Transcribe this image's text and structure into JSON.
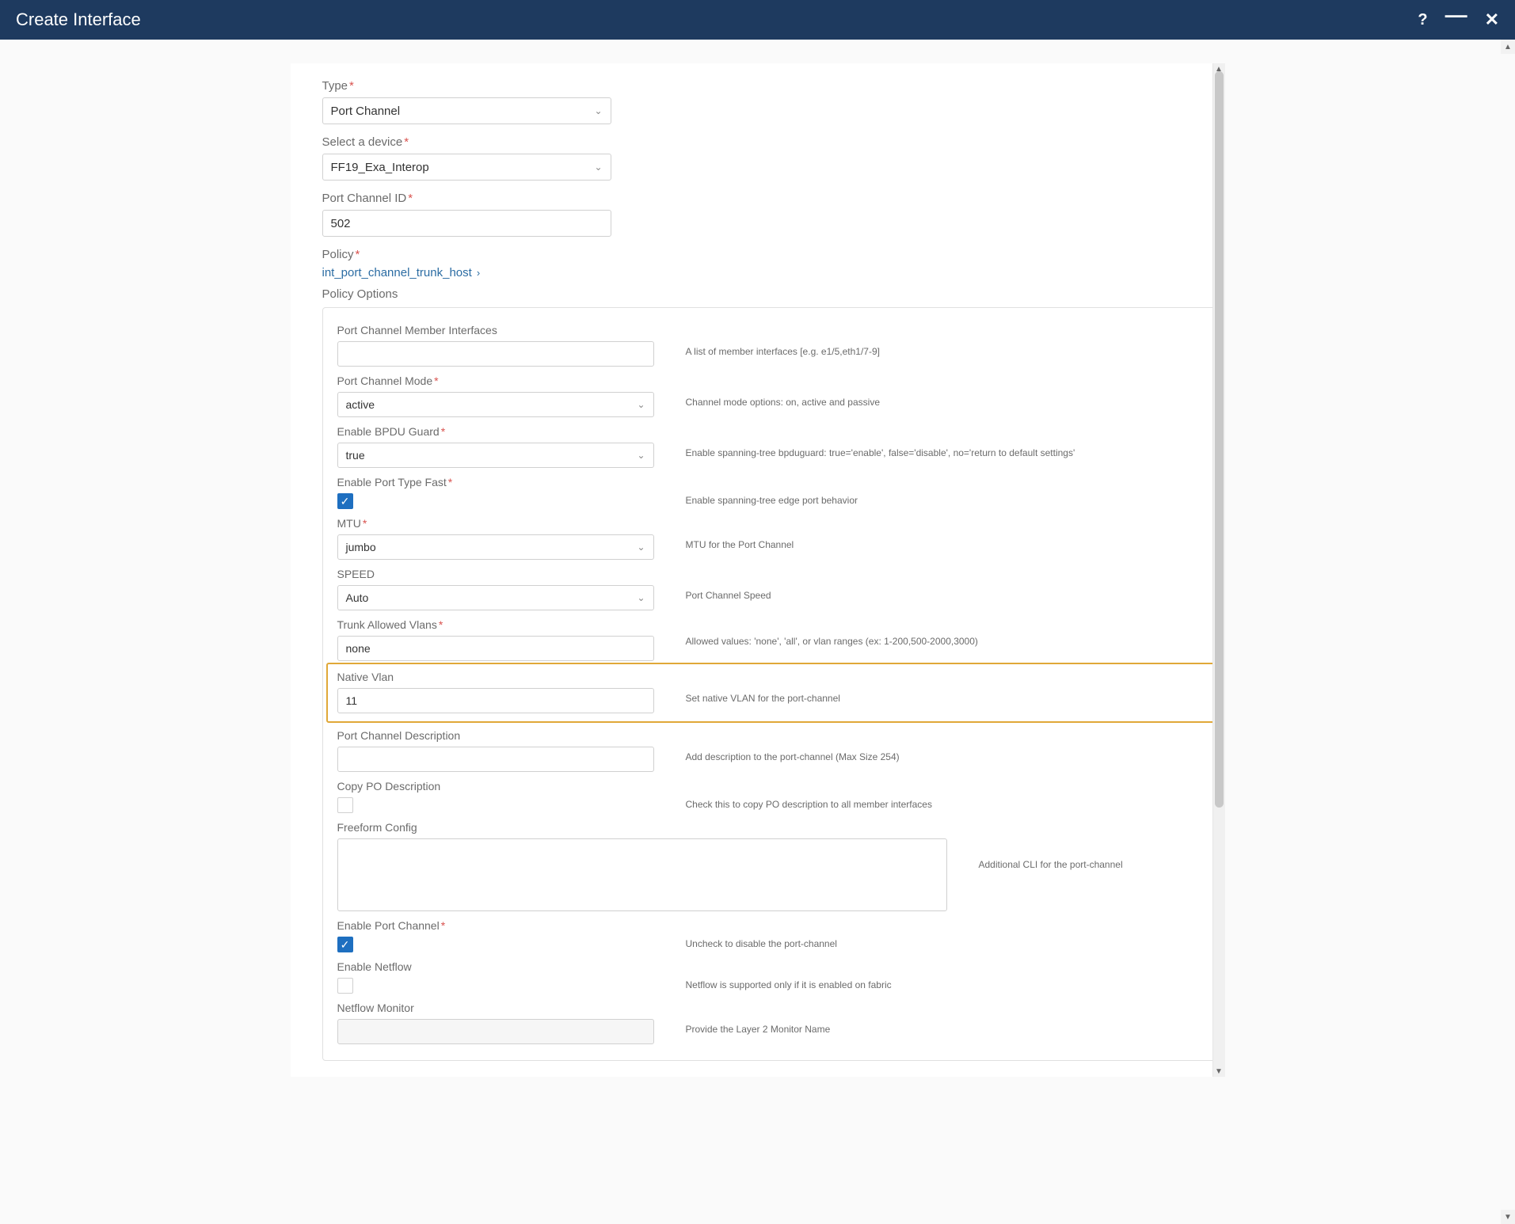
{
  "titlebar": {
    "title": "Create Interface"
  },
  "form": {
    "type": {
      "label": "Type",
      "value": "Port Channel"
    },
    "device": {
      "label": "Select a device",
      "value": "FF19_Exa_Interop"
    },
    "pcid": {
      "label": "Port Channel ID",
      "value": "502"
    },
    "policy": {
      "label": "Policy",
      "link": "int_port_channel_trunk_host"
    },
    "options_label": "Policy Options"
  },
  "opts": {
    "members": {
      "label": "Port Channel Member Interfaces",
      "value": "",
      "desc": "A list of member interfaces [e.g. e1/5,eth1/7-9]"
    },
    "mode": {
      "label": "Port Channel Mode",
      "value": "active",
      "desc": "Channel mode options: on, active and passive"
    },
    "bpdu": {
      "label": "Enable BPDU Guard",
      "value": "true",
      "desc": "Enable spanning-tree bpduguard: true='enable', false='disable', no='return to default settings'"
    },
    "ptf": {
      "label": "Enable Port Type Fast",
      "checked": true,
      "desc": "Enable spanning-tree edge port behavior"
    },
    "mtu": {
      "label": "MTU",
      "value": "jumbo",
      "desc": "MTU for the Port Channel"
    },
    "speed": {
      "label": "SPEED",
      "value": "Auto",
      "desc": "Port Channel Speed"
    },
    "tav": {
      "label": "Trunk Allowed Vlans",
      "value": "none",
      "desc": "Allowed values: 'none', 'all', or vlan ranges (ex: 1-200,500-2000,3000)"
    },
    "nv": {
      "label": "Native Vlan",
      "value": "11",
      "desc": "Set native VLAN for the port-channel"
    },
    "pcd": {
      "label": "Port Channel Description",
      "value": "",
      "desc": "Add description to the port-channel (Max Size 254)"
    },
    "copypo": {
      "label": "Copy PO Description",
      "checked": false,
      "desc": "Check this to copy PO description to all member interfaces"
    },
    "ff": {
      "label": "Freeform Config",
      "value": "",
      "desc": "Additional CLI for the port-channel"
    },
    "epc": {
      "label": "Enable Port Channel",
      "checked": true,
      "desc": "Uncheck to disable the port-channel"
    },
    "enf": {
      "label": "Enable Netflow",
      "checked": false,
      "desc": "Netflow is supported only if it is enabled on fabric"
    },
    "nfm": {
      "label": "Netflow Monitor",
      "value": "",
      "desc": "Provide the Layer 2 Monitor Name"
    }
  }
}
